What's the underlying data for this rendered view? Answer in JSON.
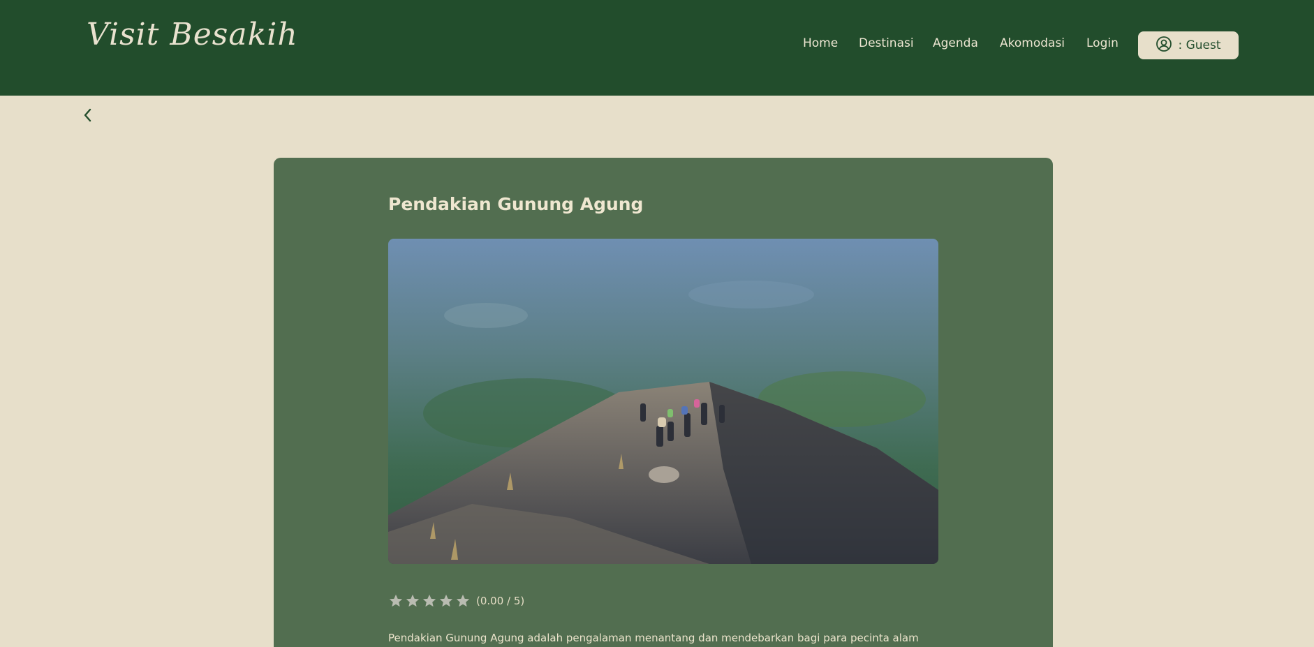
{
  "brand": {
    "logo_text": "Visit Besakih"
  },
  "nav": {
    "items": [
      {
        "label": "Home"
      },
      {
        "label": "Destinasi"
      },
      {
        "label": "Agenda"
      },
      {
        "label": "Akomodasi"
      },
      {
        "label": "Login"
      }
    ],
    "user_label": ":  Guest"
  },
  "detail": {
    "title": "Pendakian Gunung Agung",
    "rating": {
      "stars": 5,
      "filled": 0,
      "value_text": "(0.00 / 5)"
    },
    "description": "Pendakian Gunung Agung adalah pengalaman menantang dan mendebarkan bagi para pecinta alam dan"
  },
  "icons": {
    "back": "chevron-left-icon",
    "user": "user-circle-icon",
    "star": "star-icon"
  },
  "colors": {
    "header_bg": "#224d2c",
    "page_bg": "#e7dfca",
    "card_bg": "#526e50",
    "star_empty": "#b9bcb1"
  }
}
